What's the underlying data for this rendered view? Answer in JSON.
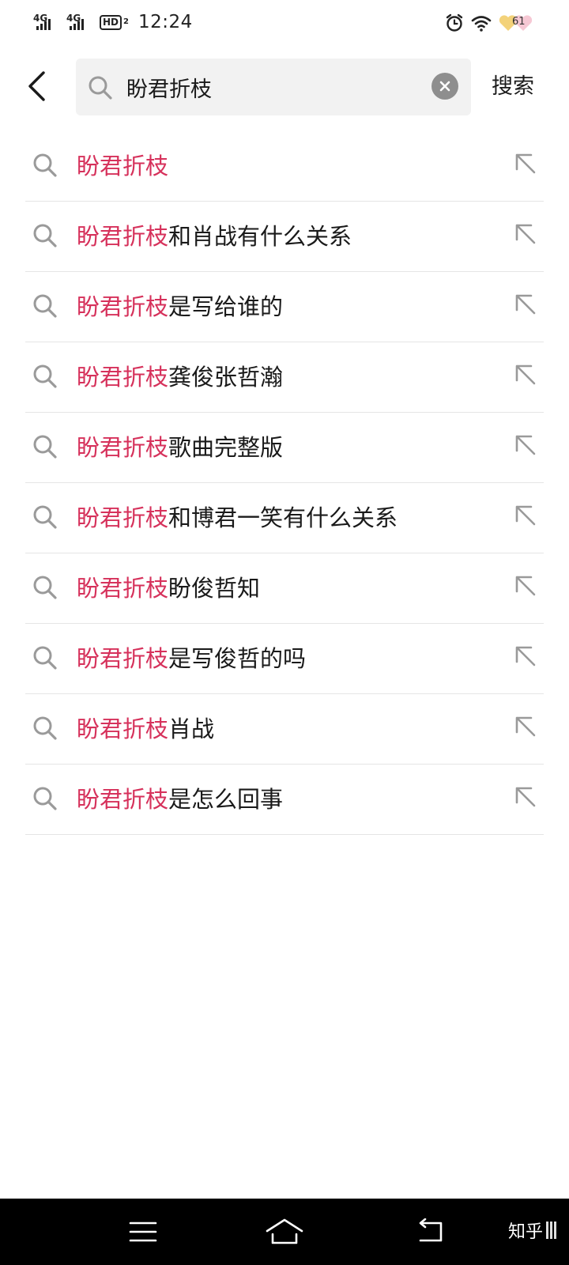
{
  "status_bar": {
    "network_1": "4G",
    "network_2": "4G",
    "hd_label": "HD",
    "hd_sub": "2",
    "time": "12:24",
    "battery_level": "61",
    "icons": [
      "alarm-icon",
      "wifi-icon",
      "battery-icon"
    ]
  },
  "header": {
    "query": "盼君折枝",
    "search_label": "搜索",
    "icons": [
      "back-arrow-icon",
      "search-icon",
      "clear-icon"
    ]
  },
  "suggestions": [
    {
      "highlight": "盼君折枝",
      "rest": ""
    },
    {
      "highlight": "盼君折枝",
      "rest": "和肖战有什么关系"
    },
    {
      "highlight": "盼君折枝",
      "rest": "是写给谁的"
    },
    {
      "highlight": "盼君折枝",
      "rest": "龚俊张哲瀚"
    },
    {
      "highlight": "盼君折枝",
      "rest": "歌曲完整版"
    },
    {
      "highlight": "盼君折枝",
      "rest": "和博君一笑有什么关系"
    },
    {
      "highlight": "盼君折枝",
      "rest": "盼俊哲知"
    },
    {
      "highlight": "盼君折枝",
      "rest": "是写俊哲的吗"
    },
    {
      "highlight": "盼君折枝",
      "rest": "肖战"
    },
    {
      "highlight": "盼君折枝",
      "rest": "是怎么回事"
    }
  ],
  "nav_bar": {
    "icons": [
      "menu-icon",
      "home-icon",
      "back-icon"
    ],
    "watermark": "知乎"
  },
  "colors": {
    "highlight": "#d6315b",
    "text": "#1a1a1a",
    "search_box_bg": "#f2f2f2",
    "divider": "#e5e5e5",
    "nav_bg": "#000000"
  }
}
